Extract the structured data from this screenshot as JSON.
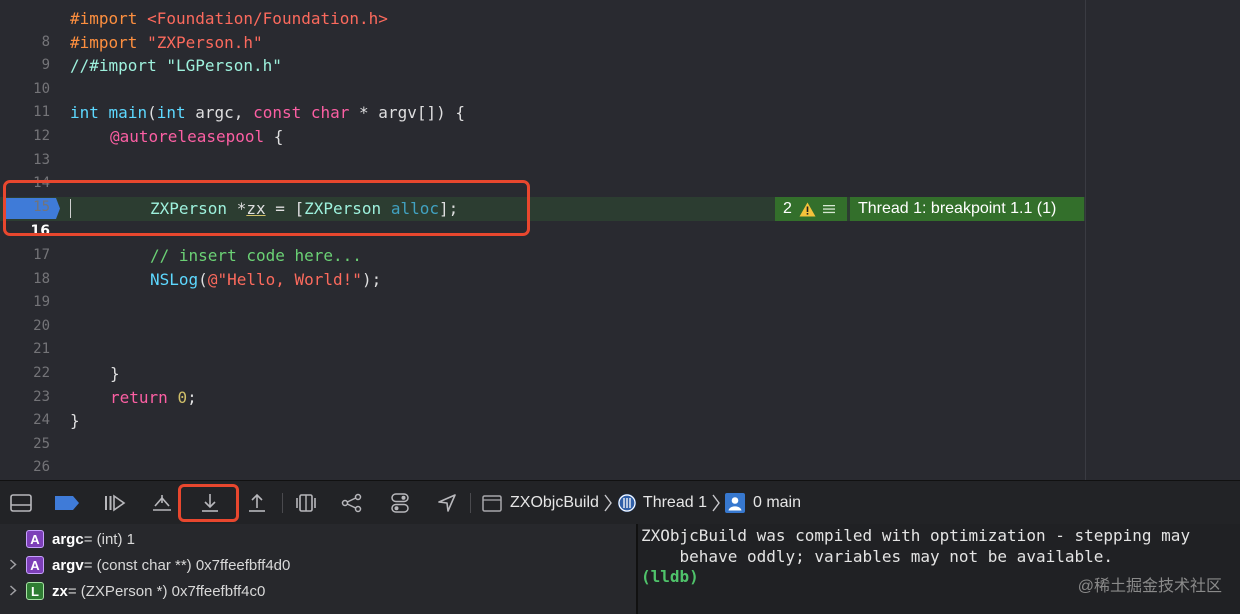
{
  "editor": {
    "lines": [
      {
        "n": "8"
      },
      {
        "n": "9"
      },
      {
        "n": "10"
      },
      {
        "n": "11"
      },
      {
        "n": "12"
      },
      {
        "n": "13"
      },
      {
        "n": "14"
      },
      {
        "n": "15"
      },
      {
        "n": "16"
      },
      {
        "n": "17"
      },
      {
        "n": "18"
      },
      {
        "n": "19"
      },
      {
        "n": "20"
      },
      {
        "n": "21"
      },
      {
        "n": "22"
      },
      {
        "n": "23"
      },
      {
        "n": "24"
      },
      {
        "n": "25"
      },
      {
        "n": "26"
      }
    ],
    "tokens": {
      "import_kw": "#import",
      "foundation": "<Foundation/Foundation.h>",
      "zxperson_h": "\"ZXPerson.h\"",
      "lg_comment": "//#import \"LGPerson.h\"",
      "int_kw": "int",
      "main": "main",
      "argc_decl": " argc, ",
      "const_kw": "const",
      "char_kw": "char",
      "argv_decl": " * argv[]) {",
      "autoreleasepool": "@autoreleasepool",
      "open_brace": " {",
      "zxperson": "ZXPerson",
      "star": " *",
      "zx": "zx",
      "assign": " = [",
      "alloc": "alloc",
      "close_msg": "];",
      "insert_comment": "// insert code here...",
      "nslog": "NSLog",
      "nslog_open": "(",
      "hello": "@\"Hello, World!\"",
      "nslog_close": ");",
      "close_brace": "}",
      "return_kw": "return",
      "zero": "0",
      "semicolon": ";",
      "space": " "
    },
    "issue_count": "2",
    "breakpoint_banner": "Thread 1: breakpoint 1.1 (1)"
  },
  "debug_bar": {
    "breadcrumb": {
      "target": "ZXObjcBuild",
      "thread": "Thread 1",
      "frame": "0 main"
    }
  },
  "variables": [
    {
      "kind": "A",
      "name": "argc",
      "detail": " = (int) 1",
      "expandable": false
    },
    {
      "kind": "A",
      "name": "argv",
      "detail": " = (const char **) 0x7ffeefbff4d0",
      "expandable": true
    },
    {
      "kind": "L",
      "name": "zx",
      "detail": " = (ZXPerson *) 0x7ffeefbff4c0",
      "expandable": true
    }
  ],
  "console": {
    "line1": "ZXObjcBuild was compiled with optimization - stepping may",
    "line2": "    behave oddly; variables may not be available.",
    "prompt": "(lldb)"
  },
  "watermark": "@稀土掘金技术社区",
  "colors": {
    "accent_blue": "#3f7bd8",
    "highlight_red": "#e8472e",
    "banner_green": "#336f2b"
  }
}
